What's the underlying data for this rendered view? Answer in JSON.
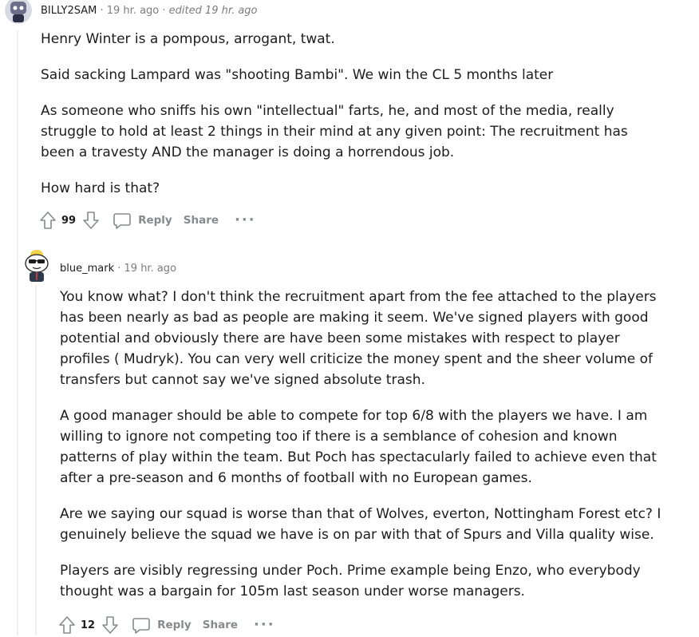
{
  "comments": [
    {
      "username": "BILLY2SAM",
      "time": "19 hr. ago",
      "edited": "edited 19 hr. ago",
      "paragraphs": [
        "Henry Winter is a pompous, arrogant, twat.",
        "Said sacking Lampard was \"shooting Bambi\". We win the CL 5 months later",
        "As someone who sniffs his own \"intellectual\" farts, he, and most of the media, really struggle to hold at least 2 things in their mind at any given point: The recruitment has been a travesty AND the manager is doing a horrendous job.",
        "How hard is that?"
      ],
      "score": "99",
      "reply_label": "Reply",
      "share_label": "Share",
      "more_label": "···"
    },
    {
      "username": "blue_mark",
      "time": "19 hr. ago",
      "paragraphs": [
        "You know what? I don't think the recruitment apart from the fee attached to the players has been nearly as bad as people are making it seem. We've signed players with good potential and obviously there are have been some mistakes with respect to player profiles ( Mudryk). You can very well criticize the money spent and the sheer volume of transfers but cannot say we've signed absolute trash.",
        "A good manager should be able to compete for top 6/8 with the players we have. I am willing to ignore not competing too if there is a semblance of cohesion and known patterns of play within the team. But Poch has spectacularly failed to achieve even that after a pre-season and 6 months of football with no European games.",
        "Are we saying our squad is worse than that of Wolves, everton, Nottingham Forest etc? I genuinely believe the squad we have is on par with that of Spurs and Villa quality wise.",
        "Players are visibly regressing under Poch. Prime example being Enzo, who everybody thought was a bargain for 105m last season under worse managers."
      ],
      "score": "12",
      "reply_label": "Reply",
      "share_label": "Share",
      "more_label": "···"
    }
  ],
  "colors": {
    "meta": "#7c7c7c",
    "actions": "#878a8c",
    "thread_line": "#edeff1"
  }
}
